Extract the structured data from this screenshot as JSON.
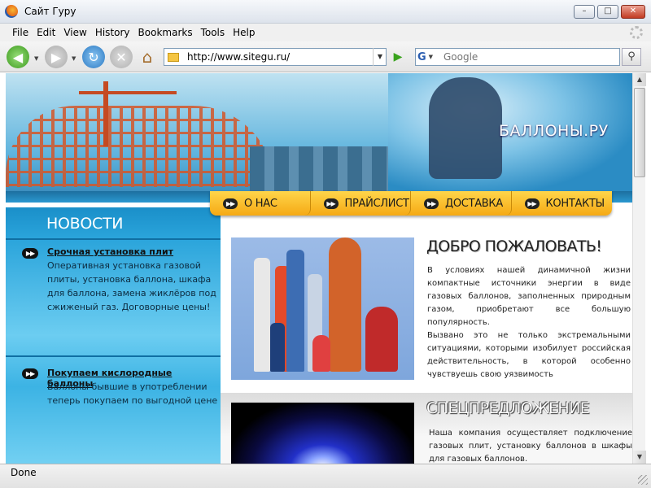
{
  "window": {
    "title": "Сайт Гуру",
    "buttons": {
      "minimize": "–",
      "maximize": "□",
      "close": "✕"
    }
  },
  "menu": [
    "File",
    "Edit",
    "View",
    "History",
    "Bookmarks",
    "Tools",
    "Help"
  ],
  "navbar": {
    "url": "http://www.sitegu.ru/",
    "search_placeholder": "Google",
    "search_engine_icon": "G"
  },
  "site": {
    "title": "БАЛЛОНЫ.РУ",
    "nav": [
      "О НАС",
      "ПРАЙСЛИСТ",
      "ДОСТАВКА",
      "КОНТАКТЫ"
    ],
    "bullet_glyph": "▶▶",
    "news_heading": "НОВОСТИ",
    "news": [
      {
        "title": "Срочная установка плит",
        "text": "Оперативная установка газовой плиты, установка баллона, шкафа для баллона, замена жиклёров под сжиженый газ. Договорные цены!"
      },
      {
        "title": "Покупаем кислородные баллоны",
        "text": "Баллоны бывшие в употреблении теперь покупаем по выгодной цене"
      }
    ],
    "welcome": {
      "title": "ДОБРО ПОЖАЛОВАТЬ!",
      "paragraph1": "В условиях нашей динамичной жизни компактные источники энергии в виде газовых баллонов, заполненных природным газом, приобретают все большую популярность.",
      "paragraph2": "Вызвано это не только экстремальными ситуациями, которыми изобилует российская действительность, в которой особенно чувствуешь свою уязвимость"
    },
    "special": {
      "title": "СПЕЦПРЕДЛОЖЕНИЕ",
      "text": "Наша компания осуществляет подключение газовых плит, установку баллонов в шкафы для газовых баллонов."
    }
  },
  "status": "Done",
  "colors": {
    "accent_yellow": "#f5a914",
    "sidebar_blue": "#2aa4db",
    "banner_blue": "#1f7fb6"
  }
}
